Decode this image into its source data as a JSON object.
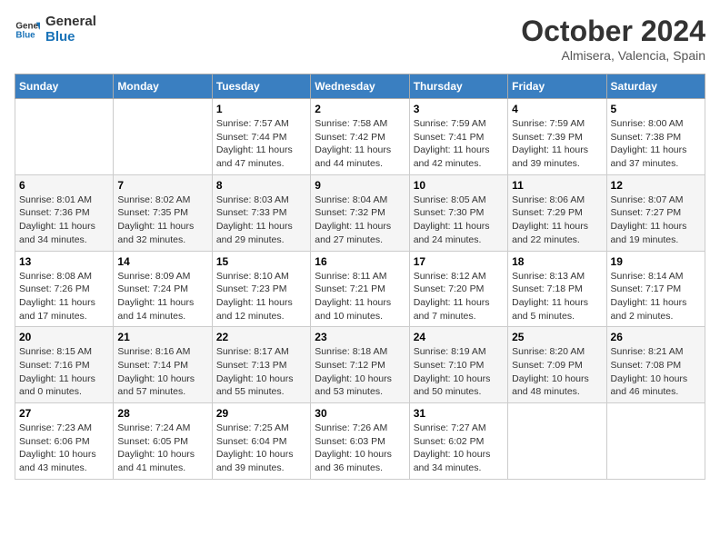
{
  "logo": {
    "line1": "General",
    "line2": "Blue"
  },
  "title": "October 2024",
  "location": "Almisera, Valencia, Spain",
  "days_of_week": [
    "Sunday",
    "Monday",
    "Tuesday",
    "Wednesday",
    "Thursday",
    "Friday",
    "Saturday"
  ],
  "weeks": [
    [
      {
        "num": "",
        "info": ""
      },
      {
        "num": "",
        "info": ""
      },
      {
        "num": "1",
        "info": "Sunrise: 7:57 AM\nSunset: 7:44 PM\nDaylight: 11 hours and 47 minutes."
      },
      {
        "num": "2",
        "info": "Sunrise: 7:58 AM\nSunset: 7:42 PM\nDaylight: 11 hours and 44 minutes."
      },
      {
        "num": "3",
        "info": "Sunrise: 7:59 AM\nSunset: 7:41 PM\nDaylight: 11 hours and 42 minutes."
      },
      {
        "num": "4",
        "info": "Sunrise: 7:59 AM\nSunset: 7:39 PM\nDaylight: 11 hours and 39 minutes."
      },
      {
        "num": "5",
        "info": "Sunrise: 8:00 AM\nSunset: 7:38 PM\nDaylight: 11 hours and 37 minutes."
      }
    ],
    [
      {
        "num": "6",
        "info": "Sunrise: 8:01 AM\nSunset: 7:36 PM\nDaylight: 11 hours and 34 minutes."
      },
      {
        "num": "7",
        "info": "Sunrise: 8:02 AM\nSunset: 7:35 PM\nDaylight: 11 hours and 32 minutes."
      },
      {
        "num": "8",
        "info": "Sunrise: 8:03 AM\nSunset: 7:33 PM\nDaylight: 11 hours and 29 minutes."
      },
      {
        "num": "9",
        "info": "Sunrise: 8:04 AM\nSunset: 7:32 PM\nDaylight: 11 hours and 27 minutes."
      },
      {
        "num": "10",
        "info": "Sunrise: 8:05 AM\nSunset: 7:30 PM\nDaylight: 11 hours and 24 minutes."
      },
      {
        "num": "11",
        "info": "Sunrise: 8:06 AM\nSunset: 7:29 PM\nDaylight: 11 hours and 22 minutes."
      },
      {
        "num": "12",
        "info": "Sunrise: 8:07 AM\nSunset: 7:27 PM\nDaylight: 11 hours and 19 minutes."
      }
    ],
    [
      {
        "num": "13",
        "info": "Sunrise: 8:08 AM\nSunset: 7:26 PM\nDaylight: 11 hours and 17 minutes."
      },
      {
        "num": "14",
        "info": "Sunrise: 8:09 AM\nSunset: 7:24 PM\nDaylight: 11 hours and 14 minutes."
      },
      {
        "num": "15",
        "info": "Sunrise: 8:10 AM\nSunset: 7:23 PM\nDaylight: 11 hours and 12 minutes."
      },
      {
        "num": "16",
        "info": "Sunrise: 8:11 AM\nSunset: 7:21 PM\nDaylight: 11 hours and 10 minutes."
      },
      {
        "num": "17",
        "info": "Sunrise: 8:12 AM\nSunset: 7:20 PM\nDaylight: 11 hours and 7 minutes."
      },
      {
        "num": "18",
        "info": "Sunrise: 8:13 AM\nSunset: 7:18 PM\nDaylight: 11 hours and 5 minutes."
      },
      {
        "num": "19",
        "info": "Sunrise: 8:14 AM\nSunset: 7:17 PM\nDaylight: 11 hours and 2 minutes."
      }
    ],
    [
      {
        "num": "20",
        "info": "Sunrise: 8:15 AM\nSunset: 7:16 PM\nDaylight: 11 hours and 0 minutes."
      },
      {
        "num": "21",
        "info": "Sunrise: 8:16 AM\nSunset: 7:14 PM\nDaylight: 10 hours and 57 minutes."
      },
      {
        "num": "22",
        "info": "Sunrise: 8:17 AM\nSunset: 7:13 PM\nDaylight: 10 hours and 55 minutes."
      },
      {
        "num": "23",
        "info": "Sunrise: 8:18 AM\nSunset: 7:12 PM\nDaylight: 10 hours and 53 minutes."
      },
      {
        "num": "24",
        "info": "Sunrise: 8:19 AM\nSunset: 7:10 PM\nDaylight: 10 hours and 50 minutes."
      },
      {
        "num": "25",
        "info": "Sunrise: 8:20 AM\nSunset: 7:09 PM\nDaylight: 10 hours and 48 minutes."
      },
      {
        "num": "26",
        "info": "Sunrise: 8:21 AM\nSunset: 7:08 PM\nDaylight: 10 hours and 46 minutes."
      }
    ],
    [
      {
        "num": "27",
        "info": "Sunrise: 7:23 AM\nSunset: 6:06 PM\nDaylight: 10 hours and 43 minutes."
      },
      {
        "num": "28",
        "info": "Sunrise: 7:24 AM\nSunset: 6:05 PM\nDaylight: 10 hours and 41 minutes."
      },
      {
        "num": "29",
        "info": "Sunrise: 7:25 AM\nSunset: 6:04 PM\nDaylight: 10 hours and 39 minutes."
      },
      {
        "num": "30",
        "info": "Sunrise: 7:26 AM\nSunset: 6:03 PM\nDaylight: 10 hours and 36 minutes."
      },
      {
        "num": "31",
        "info": "Sunrise: 7:27 AM\nSunset: 6:02 PM\nDaylight: 10 hours and 34 minutes."
      },
      {
        "num": "",
        "info": ""
      },
      {
        "num": "",
        "info": ""
      }
    ]
  ]
}
